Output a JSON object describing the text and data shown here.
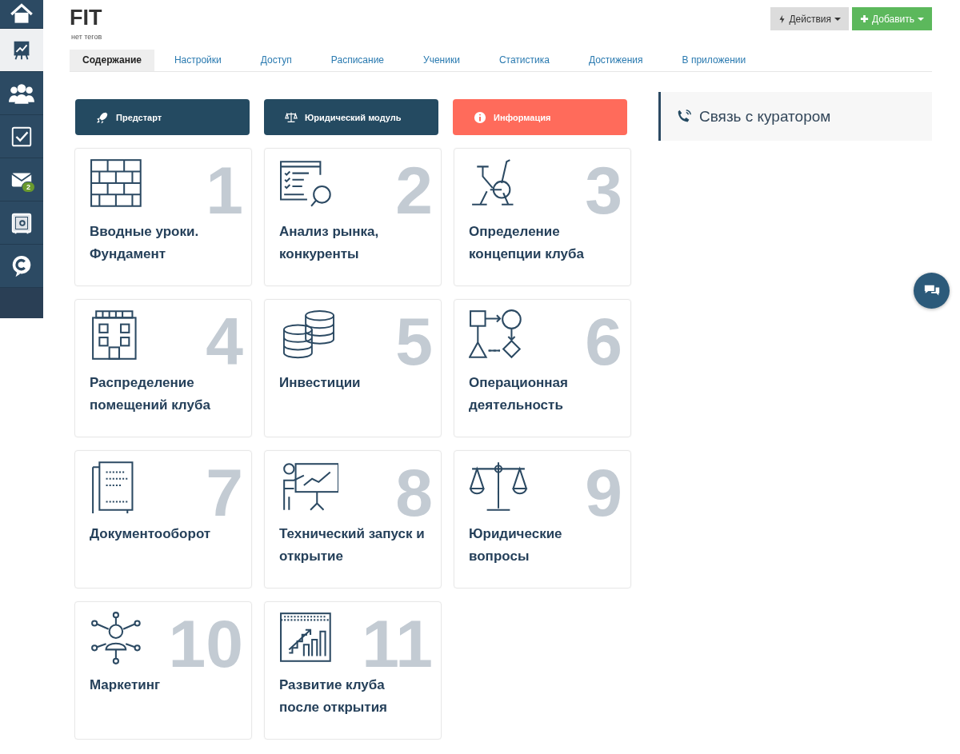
{
  "sidebar": {
    "items": [
      {
        "kind": "home",
        "selected": false
      },
      {
        "kind": "chart",
        "selected": true
      },
      {
        "kind": "people",
        "selected": false
      },
      {
        "kind": "check",
        "selected": false
      },
      {
        "kind": "mail",
        "selected": false,
        "badge": "2"
      },
      {
        "kind": "safe",
        "selected": false
      },
      {
        "kind": "c",
        "selected": false
      }
    ]
  },
  "header": {
    "title": "FIT",
    "tags": "нет тегов",
    "actions": [
      {
        "kind": "actions",
        "label": "Действия"
      },
      {
        "kind": "add",
        "label": "Добавить"
      }
    ]
  },
  "tabs": [
    {
      "label": "Содержание",
      "selected": true
    },
    {
      "label": "Настройки",
      "selected": false
    },
    {
      "label": "Доступ",
      "selected": false
    },
    {
      "label": "Расписание",
      "selected": false
    },
    {
      "label": "Ученики",
      "selected": false
    },
    {
      "label": "Статистика",
      "selected": false
    },
    {
      "label": "Достижения",
      "selected": false
    },
    {
      "label": "В приложении",
      "selected": false
    }
  ],
  "quick_buttons": [
    {
      "kind": "prestart",
      "label": "Предстарт"
    },
    {
      "kind": "legal",
      "label": "Юридический модуль"
    },
    {
      "kind": "info",
      "label": "Информация"
    }
  ],
  "modules": [
    {
      "kind": "bricks",
      "number": "1",
      "title": "Вводные уроки. Фундамент"
    },
    {
      "kind": "analysis",
      "number": "2",
      "title": "Анализ рынка, конкуренты"
    },
    {
      "kind": "bike",
      "number": "3",
      "title": "Определение концепции клуба"
    },
    {
      "kind": "building",
      "number": "4",
      "title": "Распределение помещений клуба"
    },
    {
      "kind": "coins",
      "number": "5",
      "title": "Инвестиции"
    },
    {
      "kind": "flow",
      "number": "6",
      "title": "Операционная деятельность"
    },
    {
      "kind": "docs",
      "number": "7",
      "title": "Документооборот"
    },
    {
      "kind": "presenter",
      "number": "8",
      "title": "Технический запуск и открытие"
    },
    {
      "kind": "scales",
      "number": "9",
      "title": "Юридические вопросы"
    },
    {
      "kind": "network",
      "number": "10",
      "title": "Маркетинг"
    },
    {
      "kind": "growth",
      "number": "11",
      "title": "Развитие клуба после открытия"
    }
  ],
  "curator_panel": {
    "title": "Связь с куратором"
  }
}
